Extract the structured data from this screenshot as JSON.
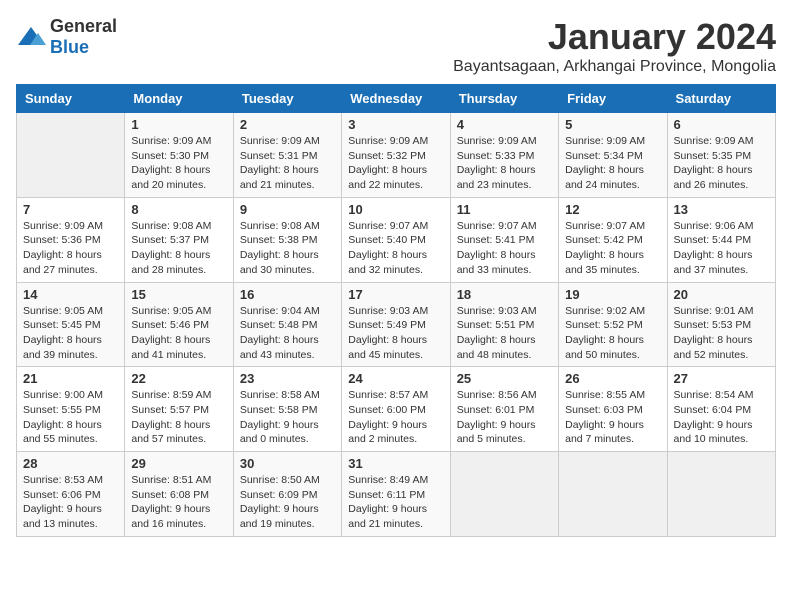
{
  "logo": {
    "general": "General",
    "blue": "Blue"
  },
  "title": "January 2024",
  "subtitle": "Bayantsagaan, Arkhangai Province, Mongolia",
  "days_of_week": [
    "Sunday",
    "Monday",
    "Tuesday",
    "Wednesday",
    "Thursday",
    "Friday",
    "Saturday"
  ],
  "weeks": [
    [
      {
        "day": "",
        "sunrise": "",
        "sunset": "",
        "daylight": ""
      },
      {
        "day": "1",
        "sunrise": "Sunrise: 9:09 AM",
        "sunset": "Sunset: 5:30 PM",
        "daylight": "Daylight: 8 hours and 20 minutes."
      },
      {
        "day": "2",
        "sunrise": "Sunrise: 9:09 AM",
        "sunset": "Sunset: 5:31 PM",
        "daylight": "Daylight: 8 hours and 21 minutes."
      },
      {
        "day": "3",
        "sunrise": "Sunrise: 9:09 AM",
        "sunset": "Sunset: 5:32 PM",
        "daylight": "Daylight: 8 hours and 22 minutes."
      },
      {
        "day": "4",
        "sunrise": "Sunrise: 9:09 AM",
        "sunset": "Sunset: 5:33 PM",
        "daylight": "Daylight: 8 hours and 23 minutes."
      },
      {
        "day": "5",
        "sunrise": "Sunrise: 9:09 AM",
        "sunset": "Sunset: 5:34 PM",
        "daylight": "Daylight: 8 hours and 24 minutes."
      },
      {
        "day": "6",
        "sunrise": "Sunrise: 9:09 AM",
        "sunset": "Sunset: 5:35 PM",
        "daylight": "Daylight: 8 hours and 26 minutes."
      }
    ],
    [
      {
        "day": "7",
        "sunrise": "Sunrise: 9:09 AM",
        "sunset": "Sunset: 5:36 PM",
        "daylight": "Daylight: 8 hours and 27 minutes."
      },
      {
        "day": "8",
        "sunrise": "Sunrise: 9:08 AM",
        "sunset": "Sunset: 5:37 PM",
        "daylight": "Daylight: 8 hours and 28 minutes."
      },
      {
        "day": "9",
        "sunrise": "Sunrise: 9:08 AM",
        "sunset": "Sunset: 5:38 PM",
        "daylight": "Daylight: 8 hours and 30 minutes."
      },
      {
        "day": "10",
        "sunrise": "Sunrise: 9:07 AM",
        "sunset": "Sunset: 5:40 PM",
        "daylight": "Daylight: 8 hours and 32 minutes."
      },
      {
        "day": "11",
        "sunrise": "Sunrise: 9:07 AM",
        "sunset": "Sunset: 5:41 PM",
        "daylight": "Daylight: 8 hours and 33 minutes."
      },
      {
        "day": "12",
        "sunrise": "Sunrise: 9:07 AM",
        "sunset": "Sunset: 5:42 PM",
        "daylight": "Daylight: 8 hours and 35 minutes."
      },
      {
        "day": "13",
        "sunrise": "Sunrise: 9:06 AM",
        "sunset": "Sunset: 5:44 PM",
        "daylight": "Daylight: 8 hours and 37 minutes."
      }
    ],
    [
      {
        "day": "14",
        "sunrise": "Sunrise: 9:05 AM",
        "sunset": "Sunset: 5:45 PM",
        "daylight": "Daylight: 8 hours and 39 minutes."
      },
      {
        "day": "15",
        "sunrise": "Sunrise: 9:05 AM",
        "sunset": "Sunset: 5:46 PM",
        "daylight": "Daylight: 8 hours and 41 minutes."
      },
      {
        "day": "16",
        "sunrise": "Sunrise: 9:04 AM",
        "sunset": "Sunset: 5:48 PM",
        "daylight": "Daylight: 8 hours and 43 minutes."
      },
      {
        "day": "17",
        "sunrise": "Sunrise: 9:03 AM",
        "sunset": "Sunset: 5:49 PM",
        "daylight": "Daylight: 8 hours and 45 minutes."
      },
      {
        "day": "18",
        "sunrise": "Sunrise: 9:03 AM",
        "sunset": "Sunset: 5:51 PM",
        "daylight": "Daylight: 8 hours and 48 minutes."
      },
      {
        "day": "19",
        "sunrise": "Sunrise: 9:02 AM",
        "sunset": "Sunset: 5:52 PM",
        "daylight": "Daylight: 8 hours and 50 minutes."
      },
      {
        "day": "20",
        "sunrise": "Sunrise: 9:01 AM",
        "sunset": "Sunset: 5:53 PM",
        "daylight": "Daylight: 8 hours and 52 minutes."
      }
    ],
    [
      {
        "day": "21",
        "sunrise": "Sunrise: 9:00 AM",
        "sunset": "Sunset: 5:55 PM",
        "daylight": "Daylight: 8 hours and 55 minutes."
      },
      {
        "day": "22",
        "sunrise": "Sunrise: 8:59 AM",
        "sunset": "Sunset: 5:57 PM",
        "daylight": "Daylight: 8 hours and 57 minutes."
      },
      {
        "day": "23",
        "sunrise": "Sunrise: 8:58 AM",
        "sunset": "Sunset: 5:58 PM",
        "daylight": "Daylight: 9 hours and 0 minutes."
      },
      {
        "day": "24",
        "sunrise": "Sunrise: 8:57 AM",
        "sunset": "Sunset: 6:00 PM",
        "daylight": "Daylight: 9 hours and 2 minutes."
      },
      {
        "day": "25",
        "sunrise": "Sunrise: 8:56 AM",
        "sunset": "Sunset: 6:01 PM",
        "daylight": "Daylight: 9 hours and 5 minutes."
      },
      {
        "day": "26",
        "sunrise": "Sunrise: 8:55 AM",
        "sunset": "Sunset: 6:03 PM",
        "daylight": "Daylight: 9 hours and 7 minutes."
      },
      {
        "day": "27",
        "sunrise": "Sunrise: 8:54 AM",
        "sunset": "Sunset: 6:04 PM",
        "daylight": "Daylight: 9 hours and 10 minutes."
      }
    ],
    [
      {
        "day": "28",
        "sunrise": "Sunrise: 8:53 AM",
        "sunset": "Sunset: 6:06 PM",
        "daylight": "Daylight: 9 hours and 13 minutes."
      },
      {
        "day": "29",
        "sunrise": "Sunrise: 8:51 AM",
        "sunset": "Sunset: 6:08 PM",
        "daylight": "Daylight: 9 hours and 16 minutes."
      },
      {
        "day": "30",
        "sunrise": "Sunrise: 8:50 AM",
        "sunset": "Sunset: 6:09 PM",
        "daylight": "Daylight: 9 hours and 19 minutes."
      },
      {
        "day": "31",
        "sunrise": "Sunrise: 8:49 AM",
        "sunset": "Sunset: 6:11 PM",
        "daylight": "Daylight: 9 hours and 21 minutes."
      },
      {
        "day": "",
        "sunrise": "",
        "sunset": "",
        "daylight": ""
      },
      {
        "day": "",
        "sunrise": "",
        "sunset": "",
        "daylight": ""
      },
      {
        "day": "",
        "sunrise": "",
        "sunset": "",
        "daylight": ""
      }
    ]
  ]
}
